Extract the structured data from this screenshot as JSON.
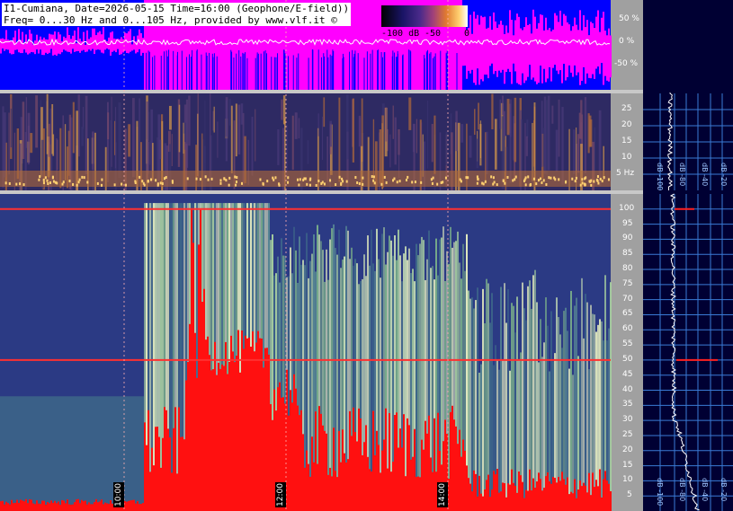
{
  "header": {
    "line1": "I1-Cumiana, Date=2026-05-15 Time=16:00 (Geophone/E-field))",
    "line2": "Freq= 0...30 Hz and 0...105 Hz, provided by www.vlf.it ©"
  },
  "legend": {
    "ticks": [
      "-100 dB",
      "-50",
      "0"
    ]
  },
  "chart_data": [
    {
      "type": "area",
      "panel": "waveform",
      "y_axis_label_suffix": "%",
      "yticks": [
        50,
        0,
        -50
      ],
      "ytick_labels": [
        "50 %",
        "0 %",
        "-50 %"
      ],
      "colors": {
        "envelope_low": "#0000ff",
        "envelope_high": "#ff00ff",
        "trace": "#ffffff"
      }
    },
    {
      "type": "heatmap",
      "panel": "spectrogram-low",
      "ylim": [
        0,
        30
      ],
      "yticks": [
        5,
        10,
        15,
        20,
        25
      ],
      "ytick_labels": [
        "5 Hz",
        "10",
        "15",
        "20",
        "25"
      ]
    },
    {
      "type": "heatmap",
      "panel": "spectrogram-high",
      "ylim": [
        0,
        105
      ],
      "yticks": [
        5,
        10,
        15,
        20,
        25,
        30,
        35,
        40,
        45,
        50,
        55,
        60,
        65,
        70,
        75,
        80,
        85,
        90,
        95,
        100
      ],
      "ytick_labels": [
        "5",
        "10",
        "15",
        "20",
        "25",
        "30",
        "35",
        "40",
        "45",
        "50",
        "55",
        "60",
        "65",
        "70",
        "75",
        "80",
        "85",
        "90",
        "95",
        "100"
      ],
      "time_markers": [
        "10:00",
        "12:00",
        "14:00"
      ],
      "notable_lines_hz": [
        50,
        100
      ]
    },
    {
      "type": "line",
      "panel": "spectrum-profile-low",
      "xtick_labels": [
        "dB -100",
        "dB -80",
        "dB -40",
        "dB -20"
      ]
    },
    {
      "type": "line",
      "panel": "spectrum-profile-high",
      "xtick_labels": [
        "dB -100",
        "dB -80",
        "dB -40",
        "dB -20"
      ]
    }
  ],
  "colors": {
    "frame": "#a0a0a0",
    "right_panel_bg": "#000033",
    "grid": "#3a7bd5",
    "peak": "#ff2020",
    "trace": "#ffffff"
  }
}
